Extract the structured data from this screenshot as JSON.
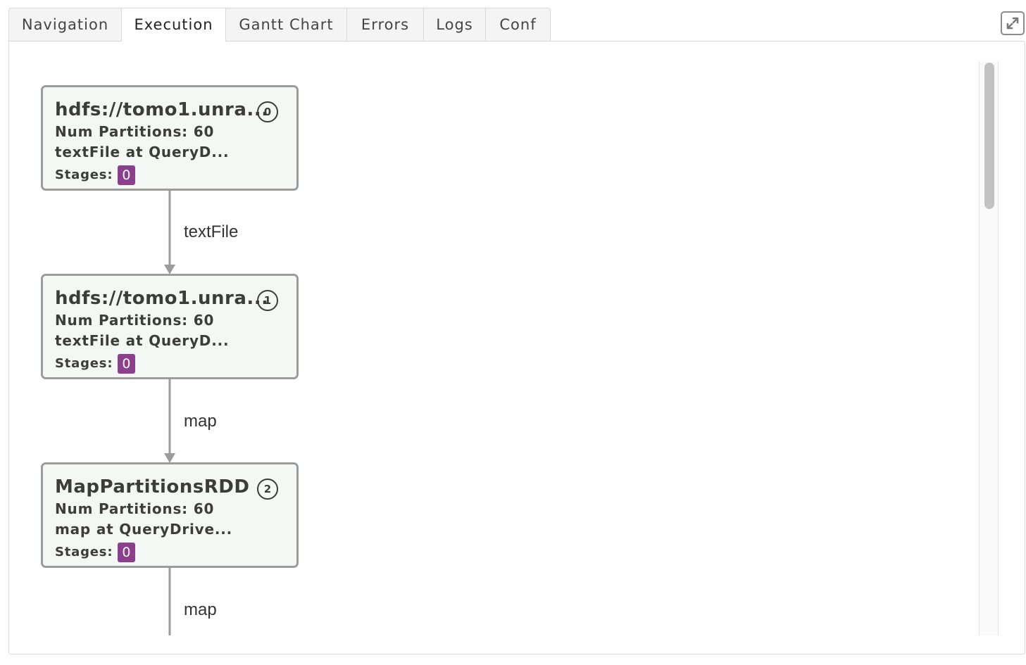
{
  "tabs": [
    {
      "label": "Navigation",
      "active": false
    },
    {
      "label": "Execution",
      "active": true
    },
    {
      "label": "Gantt Chart",
      "active": false
    },
    {
      "label": "Errors",
      "active": false
    },
    {
      "label": "Logs",
      "active": false
    },
    {
      "label": "Conf",
      "active": false
    }
  ],
  "expand_button": {
    "icon": "expand-arrows-icon"
  },
  "graph": {
    "nodes": [
      {
        "index": "0",
        "title": "hdfs://tomo1.unra...",
        "partitions": "Num Partitions: 60",
        "operation": "textFile at QueryD...",
        "stages_label": "Stages:",
        "stage": "0"
      },
      {
        "index": "1",
        "title": "hdfs://tomo1.unra...",
        "partitions": "Num Partitions: 60",
        "operation": "textFile at QueryD...",
        "stages_label": "Stages:",
        "stage": "0"
      },
      {
        "index": "2",
        "title": "MapPartitionsRDD",
        "partitions": "Num Partitions: 60",
        "operation": "map at QueryDrive...",
        "stages_label": "Stages:",
        "stage": "0"
      }
    ],
    "edges": [
      {
        "label": "textFile"
      },
      {
        "label": "map"
      },
      {
        "label": "map"
      }
    ]
  },
  "colors": {
    "stage_badge": "#8b3f8c",
    "node_fill": "#f3f8f4",
    "node_border": "#9c9c9c",
    "edge": "#9c9c9c"
  }
}
